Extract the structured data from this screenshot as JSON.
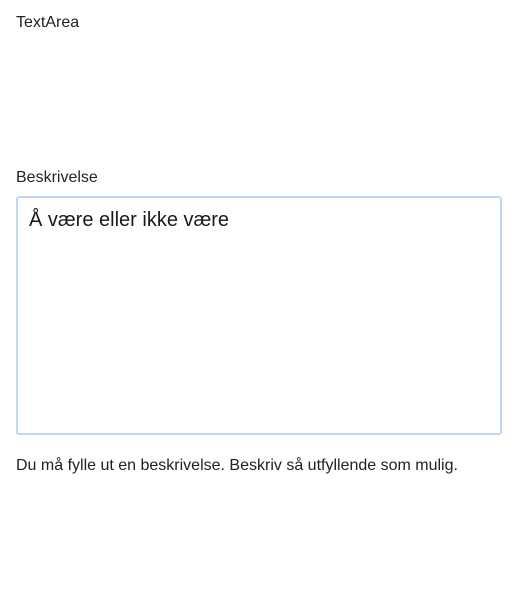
{
  "page": {
    "title": "TextArea"
  },
  "field": {
    "label": "Beskrivelse",
    "value": "Å være eller ikke være",
    "help_text": "Du må fylle ut en beskrivelse. Beskriv så utfyllende som mulig."
  },
  "colors": {
    "focus_border": "#c3d5f5",
    "text": "#222222",
    "background": "#ffffff"
  }
}
